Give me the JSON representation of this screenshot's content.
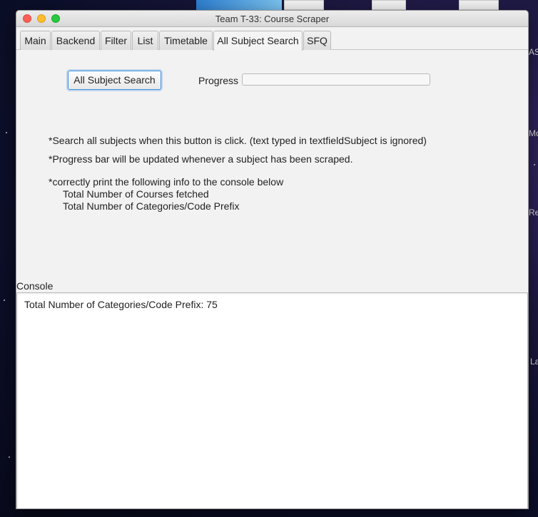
{
  "window": {
    "title": "Team T-33: Course Scraper"
  },
  "tabs": [
    {
      "label": "Main"
    },
    {
      "label": "Backend"
    },
    {
      "label": "Filter"
    },
    {
      "label": "List"
    },
    {
      "label": "Timetable"
    },
    {
      "label": "All Subject Search",
      "active": true
    },
    {
      "label": "SFQ"
    }
  ],
  "panel": {
    "search_button_label": "All Subject Search",
    "progress_label": "Progress",
    "progress_value": 0,
    "notes": [
      "*Search all subjects when this button is click. (text typed in textfieldSubject is ignored)",
      "*Progress bar will be updated whenever a subject has been scraped.",
      "*correctly print the following info to the console below",
      "Total Number of Courses fetched",
      "Total Number of Categories/Code Prefix"
    ]
  },
  "console": {
    "label": "Console",
    "text": "Total Number of Categories/Code Prefix: 75"
  },
  "desktop": {
    "edge_labels": [
      "AS",
      "Mo",
      "Re",
      "La"
    ]
  },
  "colors": {
    "accent": "#3f90dc",
    "close": "#fc5f57",
    "minimize": "#fdbc2e",
    "maximize": "#28c840"
  }
}
